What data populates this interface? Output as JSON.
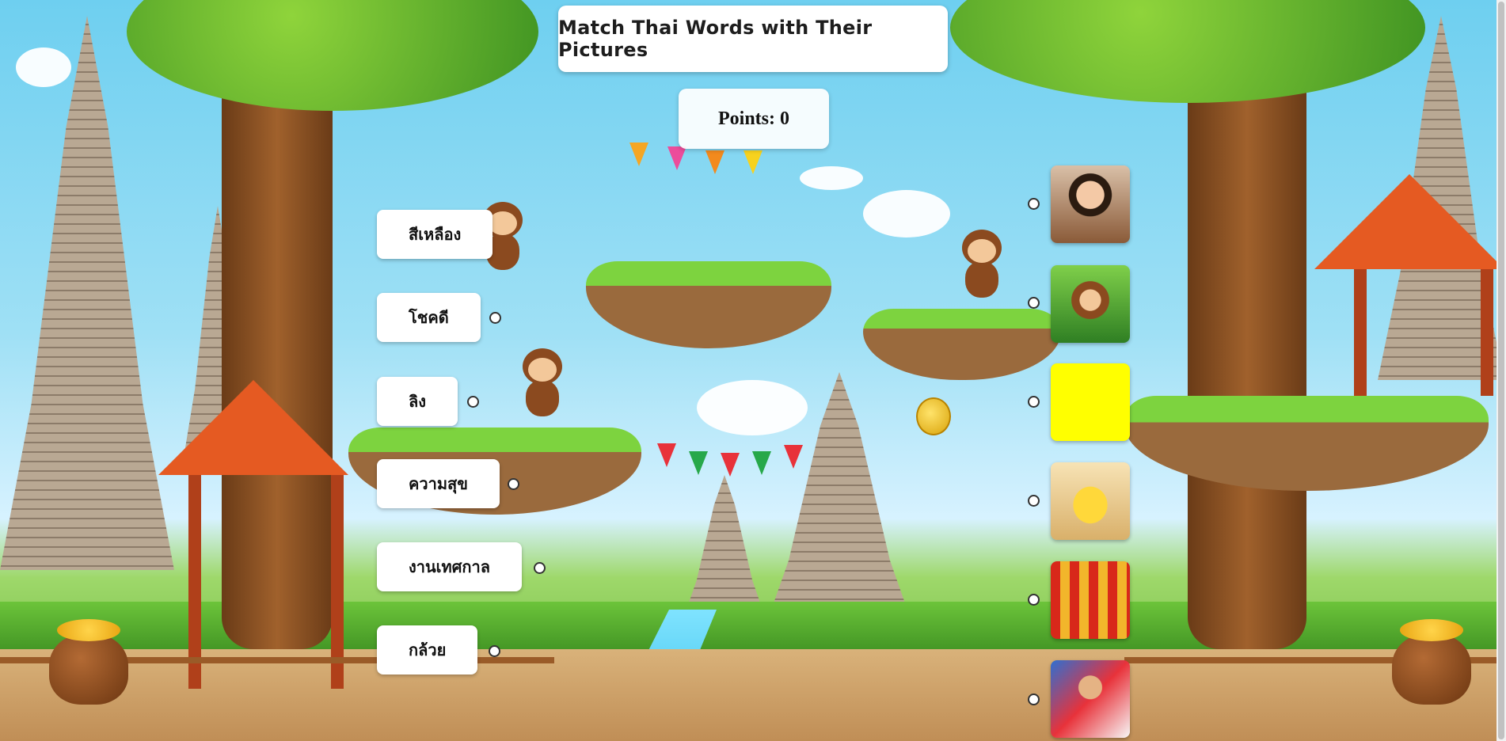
{
  "game": {
    "title": "Match Thai Words with Their Pictures",
    "points_text": "Points: 0"
  },
  "words": [
    {
      "text": "สีเหลือง"
    },
    {
      "text": "โชคดี"
    },
    {
      "text": "ลิง"
    },
    {
      "text": "ความสุข"
    },
    {
      "text": "งานเทศกาล"
    },
    {
      "text": "กล้วย"
    }
  ],
  "pictures": [
    {
      "subject": "smiling girl"
    },
    {
      "subject": "monkey"
    },
    {
      "subject": "yellow"
    },
    {
      "subject": "banana"
    },
    {
      "subject": "festival"
    },
    {
      "subject": "happy man with flag"
    }
  ],
  "colors": {
    "card_bg": "#ffffff",
    "yellow_swatch": "#ffff00"
  }
}
